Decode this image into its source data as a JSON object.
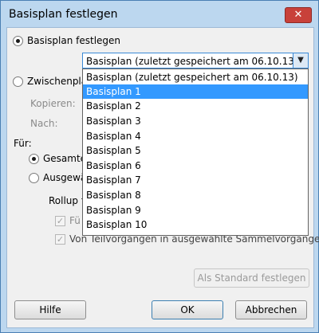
{
  "dialog": {
    "title": "Basisplan festlegen",
    "close_glyph": "✕"
  },
  "options": {
    "basisplan_radio_label": "Basisplan festlegen",
    "zwischenplan_radio_label": "Zwischenpla",
    "kopieren_label": "Kopieren:",
    "nach_label": "Nach:",
    "fuer_label": "Für:",
    "gesamt_radio_label": "Gesamte",
    "ausgewaehlt_radio_label": "Ausgewä",
    "rollup_label": "Rollup f",
    "fuer_check_label": "Fü",
    "teilvorgaenge_check_label": "Von Teilvorgängen in ausgewählte Sammelvorgänge"
  },
  "combo": {
    "selected_value": "Basisplan (zuletzt gespeichert am 06.10.13)",
    "arrow_glyph": "▼"
  },
  "dropdown": {
    "items": [
      "Basisplan (zuletzt gespeichert am 06.10.13)",
      "Basisplan 1",
      "Basisplan 2",
      "Basisplan 3",
      "Basisplan 4",
      "Basisplan 5",
      "Basisplan 6",
      "Basisplan 7",
      "Basisplan 8",
      "Basisplan 9",
      "Basisplan 10"
    ],
    "highlighted": "Basisplan 1"
  },
  "buttons": {
    "als_standard": "Als Standard festlegen",
    "hilfe": "Hilfe",
    "ok": "OK",
    "abbrechen": "Abbrechen"
  },
  "colors": {
    "highlight": "#3399ff",
    "close_button": "#c8413a"
  }
}
